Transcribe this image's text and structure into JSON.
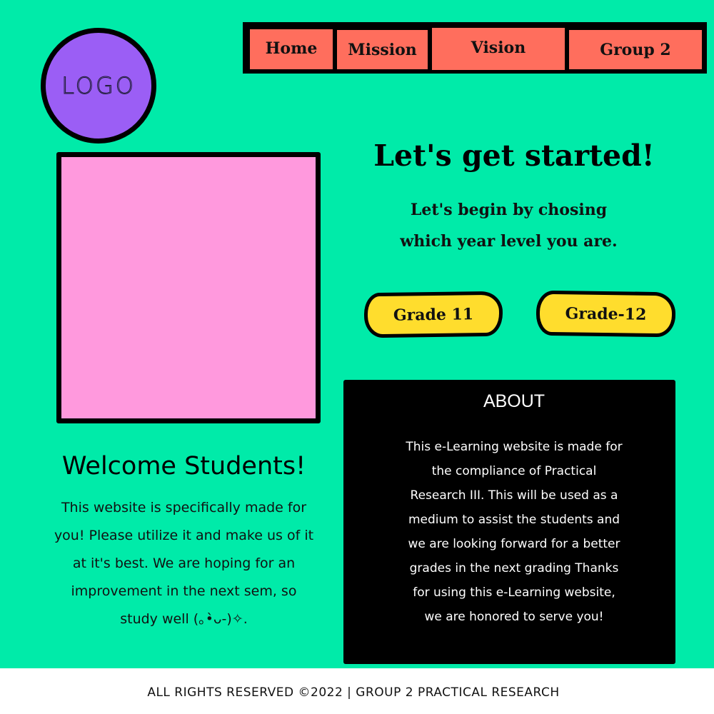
{
  "logo": {
    "text": "LOGO"
  },
  "nav": {
    "items": [
      {
        "label": "Home"
      },
      {
        "label": "Mission"
      },
      {
        "label": "Vision"
      },
      {
        "label": "Group 2"
      }
    ]
  },
  "hero": {
    "title": "Let's get started!",
    "subtitle_lines": [
      "Let's begin by chosing",
      "which year level you are."
    ],
    "buttons": [
      {
        "label": "Grade 11"
      },
      {
        "label": "Grade-12"
      }
    ]
  },
  "welcome": {
    "title": "Welcome Students!",
    "lines": [
      "This website is specifically made for",
      "you! Please utilize it and make us of it",
      "at it's best. We are hoping for an",
      "improvement in the next sem, so",
      "study well (｡•̀ᴗ-)✧."
    ]
  },
  "about": {
    "title": "ABOUT",
    "lines": [
      "This e-Learning website is made for",
      "the compliance of Practical",
      "Research III. This will be used as a",
      "medium to assist the students and",
      "we are looking forward for a better",
      "grades in the next grading  Thanks",
      "for using this e-Learning website,",
      "we are honored to serve you!"
    ]
  },
  "footer": {
    "text": "ALL RIGHTS RESERVED ©2022 | GROUP 2 PRACTICAL RESEARCH"
  },
  "colors": {
    "background": "#00eba9",
    "logo": "#9b5ef5",
    "nav": "#ff6e5d",
    "image_placeholder": "#ff99dd",
    "grade_buttons": "#ffdd2d",
    "about_panel": "#000000"
  }
}
